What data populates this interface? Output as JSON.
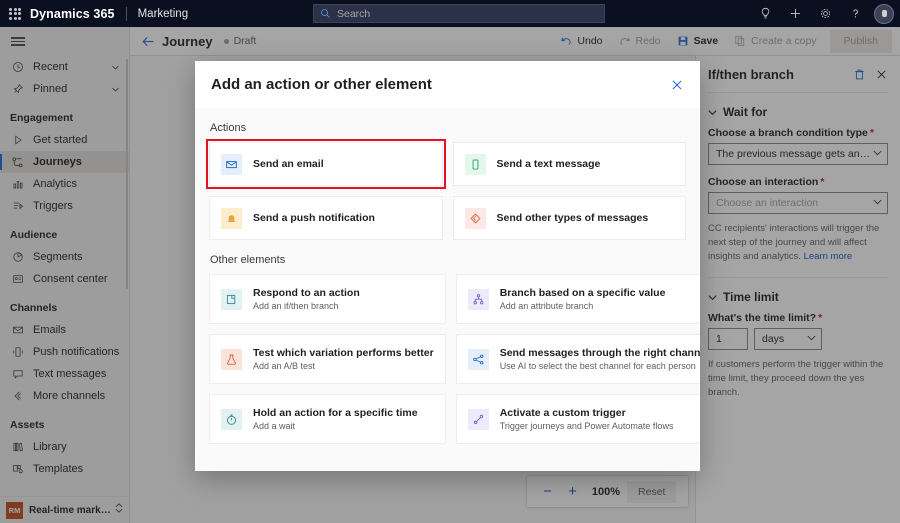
{
  "suitebar": {
    "waffle_label": "app-launcher",
    "brand": "Dynamics 365",
    "app_name": "Marketing",
    "search_placeholder": "Search",
    "icons": [
      "lightbulb-icon",
      "plus-icon",
      "gear-icon",
      "help-icon",
      "avatar"
    ]
  },
  "sidebar": {
    "hamburger_label": "menu",
    "quick": [
      {
        "label": "Recent",
        "icon": "clock-icon",
        "expandable": true
      },
      {
        "label": "Pinned",
        "icon": "pin-icon",
        "expandable": true
      }
    ],
    "groups": [
      {
        "title": "Engagement",
        "items": [
          {
            "label": "Get started",
            "icon": "play-icon",
            "active": false
          },
          {
            "label": "Journeys",
            "icon": "journeys-icon",
            "active": true
          },
          {
            "label": "Analytics",
            "icon": "analytics-icon",
            "active": false
          },
          {
            "label": "Triggers",
            "icon": "triggers-icon",
            "active": false
          }
        ]
      },
      {
        "title": "Audience",
        "items": [
          {
            "label": "Segments",
            "icon": "segments-icon",
            "active": false
          },
          {
            "label": "Consent center",
            "icon": "consent-icon",
            "active": false
          }
        ]
      },
      {
        "title": "Channels",
        "items": [
          {
            "label": "Emails",
            "icon": "email-icon",
            "active": false
          },
          {
            "label": "Push notifications",
            "icon": "push-icon",
            "active": false
          },
          {
            "label": "Text messages",
            "icon": "sms-icon",
            "active": false
          },
          {
            "label": "More channels",
            "icon": "more-channels-icon",
            "active": false
          }
        ]
      },
      {
        "title": "Assets",
        "items": [
          {
            "label": "Library",
            "icon": "library-icon",
            "active": false
          },
          {
            "label": "Templates",
            "icon": "templates-icon",
            "active": false
          }
        ]
      }
    ],
    "area_switcher": {
      "badge": "RM",
      "label": "Real-time marketi..."
    }
  },
  "commandbar": {
    "back_label": "back-arrow",
    "title": "Journey",
    "status": "Draft",
    "buttons": [
      {
        "label": "Undo",
        "icon": "undo-icon",
        "disabled": false
      },
      {
        "label": "Redo",
        "icon": "redo-icon",
        "disabled": true
      },
      {
        "label": "Save",
        "icon": "save-icon",
        "disabled": false
      },
      {
        "label": "Create a copy",
        "icon": "copy-icon",
        "disabled": true
      }
    ],
    "publish_label": "Publish"
  },
  "canvas": {
    "zoom": {
      "minus_label": "−",
      "plus_label": "+",
      "level": "100%",
      "reset_label": "Reset"
    }
  },
  "properties_panel": {
    "title": "If/then branch",
    "delete_icon": "trash-icon",
    "close_icon": "close-icon",
    "sections": [
      {
        "title": "Wait for",
        "fields": [
          {
            "label": "Choose a branch condition type",
            "required": true,
            "value": "The previous message gets an interacti...",
            "is_placeholder": false
          },
          {
            "label": "Choose an interaction",
            "required": true,
            "value": "Choose an interaction",
            "is_placeholder": true
          }
        ],
        "help": "CC recipients' interactions will trigger the next step of the journey and will affect insights and analytics.",
        "help_link": "Learn more"
      },
      {
        "title": "Time limit",
        "time_label": "What's the time limit?",
        "time_required": true,
        "time_value": "1",
        "time_unit": "days",
        "help": "If customers perform the trigger within the time limit, they proceed down the yes branch."
      }
    ]
  },
  "dialog": {
    "title": "Add an action or other element",
    "close_label": "close-icon",
    "sections": [
      {
        "label": "Actions",
        "cards": [
          {
            "title": "Send an email",
            "subtitle": "",
            "icon": "envelope-icon",
            "tile_bg": "#e5effb",
            "tile_fg": "#2b6cd4",
            "highlighted": true
          },
          {
            "title": "Send a text message",
            "subtitle": "",
            "icon": "phone-icon",
            "tile_bg": "#e4f7ed",
            "tile_fg": "#3fa06a",
            "highlighted": false
          },
          {
            "title": "Send a push notification",
            "subtitle": "",
            "icon": "bell-icon",
            "tile_bg": "#fdeccd",
            "tile_fg": "#e8a33d",
            "highlighted": false
          },
          {
            "title": "Send other types of messages",
            "subtitle": "",
            "icon": "diamond-icon",
            "tile_bg": "#fde9e4",
            "tile_fg": "#e06a4a",
            "highlighted": false
          }
        ]
      },
      {
        "label": "Other elements",
        "cards": [
          {
            "title": "Respond to an action",
            "subtitle": "Add an if/then branch",
            "icon": "respond-icon",
            "tile_bg": "#e2f1f1",
            "tile_fg": "#3f8e9a",
            "highlighted": false
          },
          {
            "title": "Branch based on a specific value",
            "subtitle": "Add an attribute branch",
            "icon": "branch-icon",
            "tile_bg": "#eceafb",
            "tile_fg": "#6b63c9",
            "highlighted": false
          },
          {
            "title": "Test which variation performs better",
            "subtitle": "Add an A/B test",
            "icon": "flask-icon",
            "tile_bg": "#fbe3da",
            "tile_fg": "#d9603f",
            "highlighted": false
          },
          {
            "title": "Send messages through the right channel",
            "subtitle": "Use AI to select the best channel for each person",
            "icon": "channel-ai-icon",
            "tile_bg": "#e5effb",
            "tile_fg": "#2b6cd4",
            "highlighted": false
          },
          {
            "title": "Hold an action for a specific time",
            "subtitle": "Add a wait",
            "icon": "timer-icon",
            "tile_bg": "#e2f1f1",
            "tile_fg": "#3f8e9a",
            "highlighted": false
          },
          {
            "title": "Activate a custom trigger",
            "subtitle": "Trigger journeys and Power Automate flows",
            "icon": "custom-trigger-icon",
            "tile_bg": "#eceafb",
            "tile_fg": "#6b63c9",
            "highlighted": false
          }
        ]
      }
    ]
  },
  "colors": {
    "accent": "#2266e3",
    "suitebar_bg": "#0b1021",
    "highlight_outline": "#e81123",
    "required_marker": "#a4262c"
  }
}
